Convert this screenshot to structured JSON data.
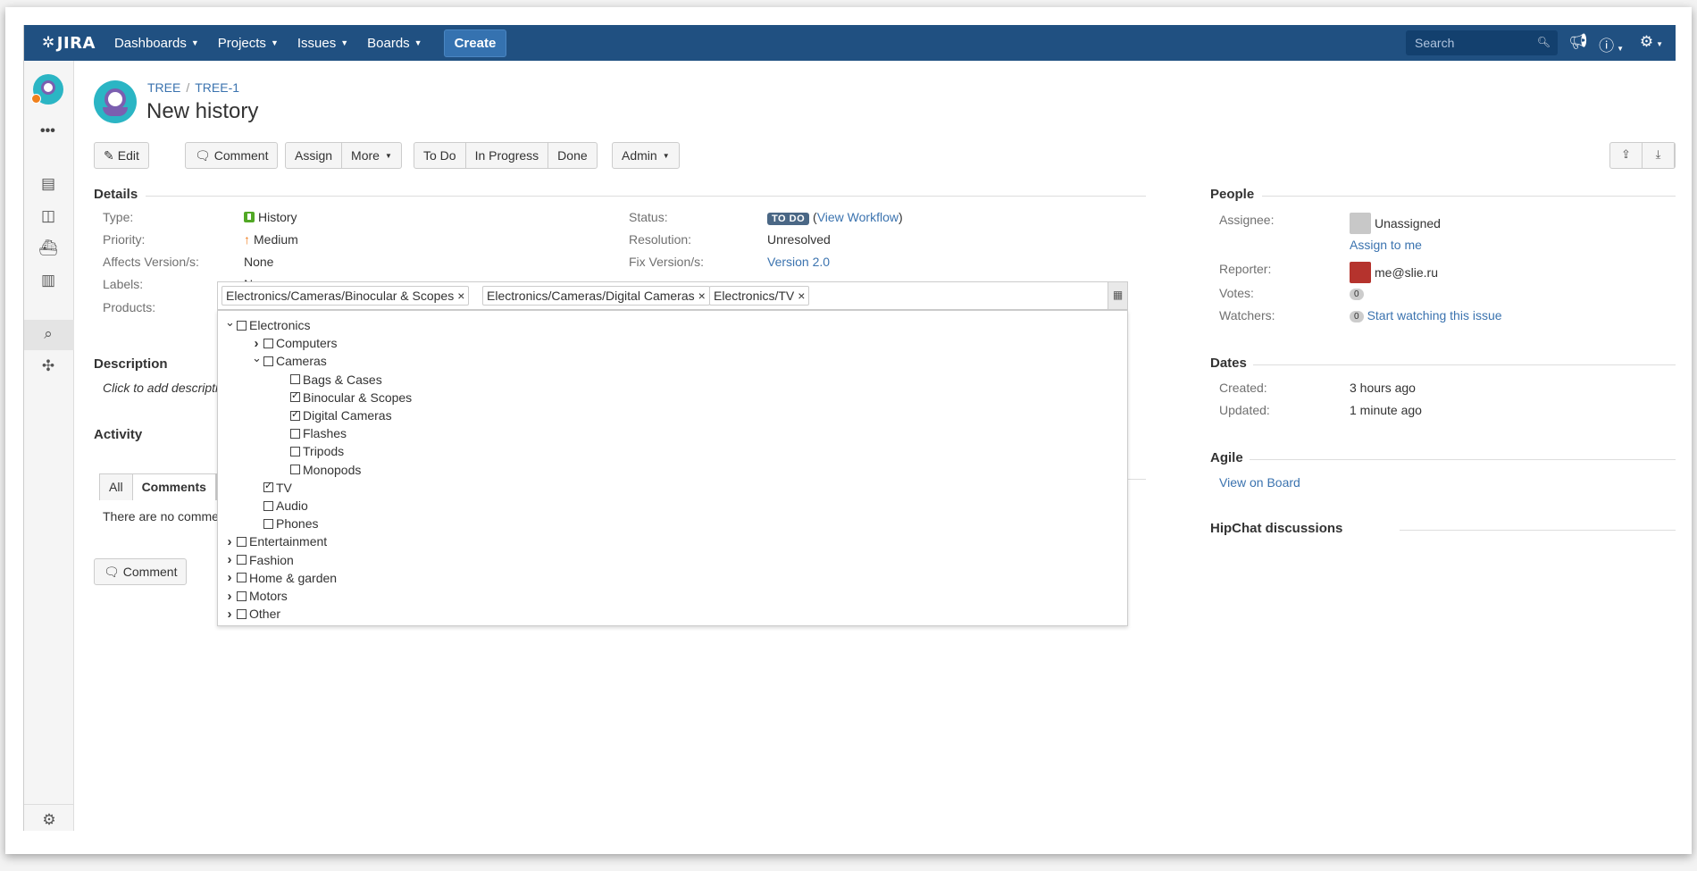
{
  "nav": {
    "logo": "JIRA",
    "items": [
      "Dashboards",
      "Projects",
      "Issues",
      "Boards"
    ],
    "create": "Create",
    "search_placeholder": "Search"
  },
  "breadcrumb": {
    "project": "TREE",
    "issue": "TREE-1"
  },
  "issue_title": "New history",
  "toolbar": {
    "edit": "Edit",
    "comment": "Comment",
    "assign": "Assign",
    "more": "More",
    "todo": "To Do",
    "in_progress": "In Progress",
    "done": "Done",
    "admin": "Admin"
  },
  "details": {
    "header": "Details",
    "type_label": "Type:",
    "type_value": "History",
    "priority_label": "Priority:",
    "priority_value": "Medium",
    "affects_label": "Affects Version/s:",
    "affects_value": "None",
    "labels_label": "Labels:",
    "labels_value": "None",
    "products_label": "Products:",
    "status_label": "Status:",
    "status_value": "TO DO",
    "workflow_link": "View Workflow",
    "resolution_label": "Resolution:",
    "resolution_value": "Unresolved",
    "fixversion_label": "Fix Version/s:",
    "fixversion_value": "Version 2.0"
  },
  "products": {
    "tags": [
      "Electronics/Cameras/Binocular & Scopes",
      "Electronics/Cameras/Digital Cameras",
      "Electronics/TV"
    ],
    "tree": [
      {
        "label": "Electronics",
        "level": 0,
        "expander": "open",
        "checked": false
      },
      {
        "label": "Computers",
        "level": 1,
        "expander": "closed",
        "checked": false
      },
      {
        "label": "Cameras",
        "level": 1,
        "expander": "open",
        "checked": false
      },
      {
        "label": "Bags & Cases",
        "level": 2,
        "expander": "none",
        "checked": false
      },
      {
        "label": "Binocular & Scopes",
        "level": 2,
        "expander": "none",
        "checked": true
      },
      {
        "label": "Digital Cameras",
        "level": 2,
        "expander": "none",
        "checked": true
      },
      {
        "label": "Flashes",
        "level": 2,
        "expander": "none",
        "checked": false
      },
      {
        "label": "Tripods",
        "level": 2,
        "expander": "none",
        "checked": false
      },
      {
        "label": "Monopods",
        "level": 2,
        "expander": "none",
        "checked": false
      },
      {
        "label": "TV",
        "level": 1,
        "expander": "none",
        "checked": true
      },
      {
        "label": "Audio",
        "level": 1,
        "expander": "none",
        "checked": false
      },
      {
        "label": "Phones",
        "level": 1,
        "expander": "none",
        "checked": false
      },
      {
        "label": "Entertainment",
        "level": 0,
        "expander": "closed",
        "checked": false
      },
      {
        "label": "Fashion",
        "level": 0,
        "expander": "closed",
        "checked": false
      },
      {
        "label": "Home & garden",
        "level": 0,
        "expander": "closed",
        "checked": false
      },
      {
        "label": "Motors",
        "level": 0,
        "expander": "closed",
        "checked": false
      },
      {
        "label": "Other",
        "level": 0,
        "expander": "closed",
        "checked": false
      }
    ]
  },
  "description": {
    "header": "Description",
    "placeholder": "Click to add description"
  },
  "activity": {
    "header": "Activity",
    "tabs": [
      "All",
      "Comments"
    ],
    "empty": "There are no comments",
    "comment_button": "Comment"
  },
  "people": {
    "header": "People",
    "assignee_label": "Assignee:",
    "assignee_value": "Unassigned",
    "assign_to_me": "Assign to me",
    "reporter_label": "Reporter:",
    "reporter_value": "me@slie.ru",
    "votes_label": "Votes:",
    "votes_count": "0",
    "watchers_label": "Watchers:",
    "watchers_count": "0",
    "watch_link": "Start watching this issue"
  },
  "dates": {
    "header": "Dates",
    "created_label": "Created:",
    "created_value": "3 hours ago",
    "updated_label": "Updated:",
    "updated_value": "1 minute ago"
  },
  "agile": {
    "header": "Agile",
    "link": "View on Board"
  },
  "hipchat": {
    "header": "HipChat discussions"
  },
  "colors": {
    "nav_bg": "#205081",
    "link": "#3b73af",
    "status_lozenge": "#4a6785",
    "history_icon": "#51a825",
    "priority_medium": "#f07c1c"
  }
}
